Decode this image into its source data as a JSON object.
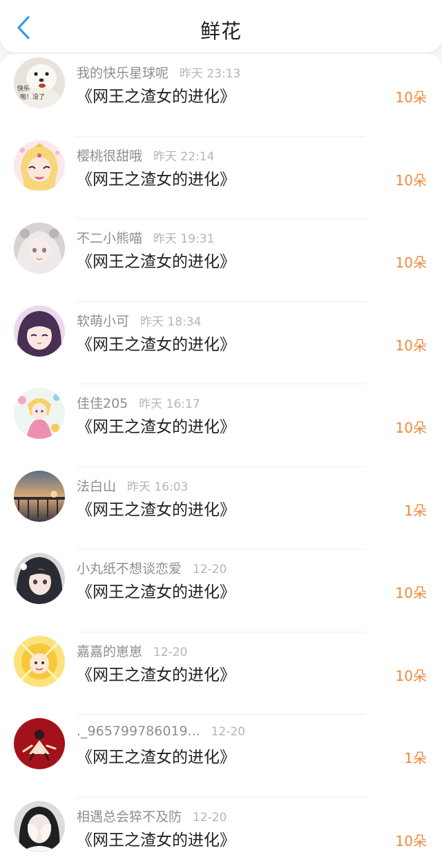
{
  "header": {
    "title": "鲜花",
    "back_icon": "chevron-left-icon",
    "accent": "#2f9cf5"
  },
  "colors": {
    "amount": "#f0893d",
    "username": "#8e8e8e",
    "time": "#b5b5b5"
  },
  "list": {
    "items": [
      {
        "username": "我的快乐星球呢",
        "time": "昨天 23:13",
        "book": "《网王之渣女的进化》",
        "amount": "10朵",
        "avatar_text": "快乐 啪！没了"
      },
      {
        "username": "樱桃很甜哦",
        "time": "昨天 22:14",
        "book": "《网王之渣女的进化》",
        "amount": "10朵",
        "avatar_text": ""
      },
      {
        "username": "不二小熊喵",
        "time": "昨天 19:31",
        "book": "《网王之渣女的进化》",
        "amount": "10朵",
        "avatar_text": ""
      },
      {
        "username": "软萌小可",
        "time": "昨天 18:34",
        "book": "《网王之渣女的进化》",
        "amount": "10朵",
        "avatar_text": ""
      },
      {
        "username": "佳佳205",
        "time": "昨天 16:17",
        "book": "《网王之渣女的进化》",
        "amount": "10朵",
        "avatar_text": ""
      },
      {
        "username": "法白山",
        "time": "昨天 16:03",
        "book": "《网王之渣女的进化》",
        "amount": "1朵",
        "avatar_text": ""
      },
      {
        "username": "小丸纸不想谈恋爱",
        "time": "12-20",
        "book": "《网王之渣女的进化》",
        "amount": "10朵",
        "avatar_text": ""
      },
      {
        "username": "嘉嘉的崽崽",
        "time": "12-20",
        "book": "《网王之渣女的进化》",
        "amount": "10朵",
        "avatar_text": ""
      },
      {
        "username": "._965799786019...",
        "time": "12-20",
        "book": "《网王之渣女的进化》",
        "amount": "1朵",
        "avatar_text": ""
      },
      {
        "username": "相遇总会猝不及防",
        "time": "12-20",
        "book": "《网王之渣女的进化》",
        "amount": "10朵",
        "avatar_text": ""
      }
    ]
  }
}
